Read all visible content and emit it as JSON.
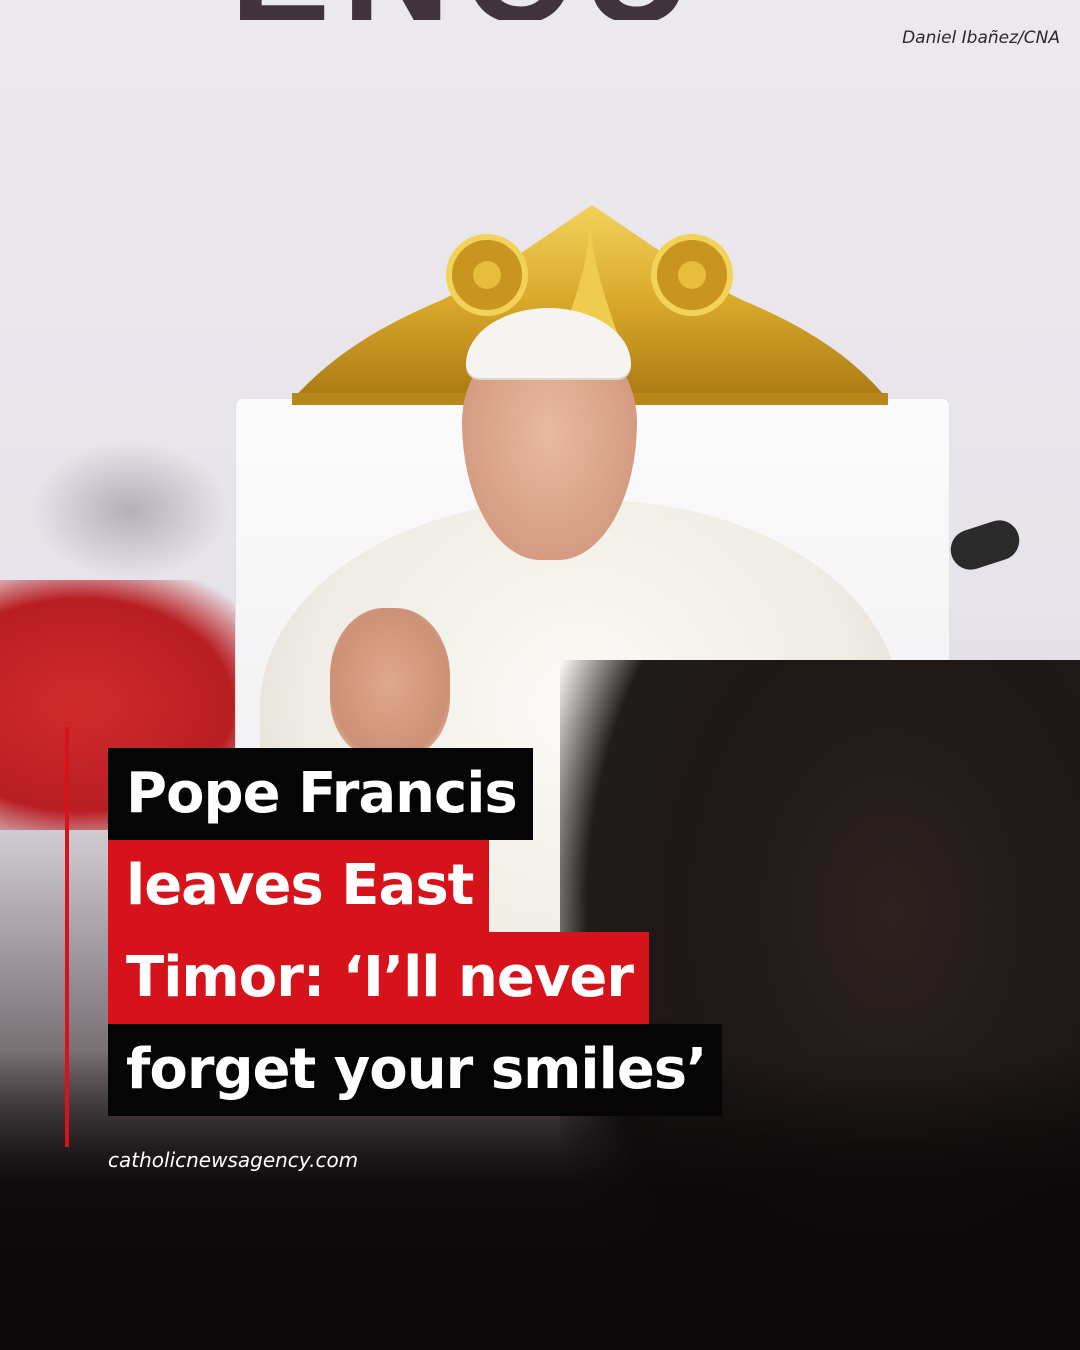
{
  "photo": {
    "credit": "Daniel Ibañez/CNA",
    "subject": "pope-on-throne-photo"
  },
  "headline": {
    "lines": [
      {
        "text": "Pope Francis",
        "highlight": "#050505"
      },
      {
        "text": "leaves East",
        "highlight": "#d6121b"
      },
      {
        "text": "Timor: ‘I’ll never",
        "highlight": "#d6121b"
      },
      {
        "text": "forget your smiles’",
        "highlight": "#050505"
      }
    ]
  },
  "source": {
    "url": "catholicnewsagency.com"
  },
  "colors": {
    "accent_red": "#d6121b",
    "highlight_black": "#050505",
    "text_white": "#ffffff"
  }
}
